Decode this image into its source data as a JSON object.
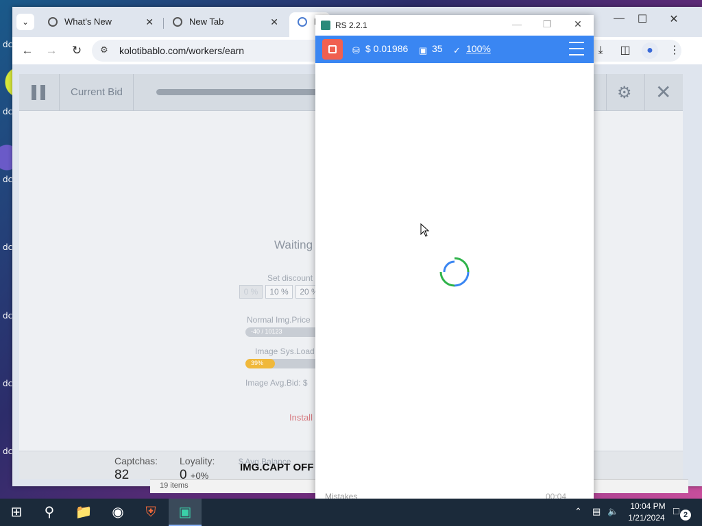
{
  "browser": {
    "tabs": [
      {
        "title": "What's New"
      },
      {
        "title": "New Tab"
      },
      {
        "title": "K"
      }
    ],
    "url": "kolotibablo.com/workers/earn"
  },
  "worker": {
    "current_bid_label": "Current Bid",
    "waiting_text": "Waiting",
    "discount_label": "Set discount",
    "discount_options": [
      "0 %",
      "10 %",
      "20 %"
    ],
    "normal_price_label": "Normal Img.Price",
    "normal_price_value": "-40 / 10123",
    "sys_load_label": "Image Sys.Load",
    "sys_load_value": "39%",
    "sys_load_fraction": 0.39,
    "avg_bid_label": "Image Avg.Bid: $",
    "install_text": "Install",
    "footer": {
      "captchas_label": "Captchas:",
      "captchas_value": "82",
      "loyalty_label": "Loyality:",
      "loyalty_value": "0",
      "loyalty_change": "+0%",
      "avg_balance_label": "$ Avg.Balance",
      "imgcapt_status": "IMG.CAPT OFF"
    }
  },
  "rs_window": {
    "title": "RS 2.2.1",
    "balance": "$ 0.01986",
    "images": "35",
    "accuracy": "100%",
    "mistakes_label": "Mistakes",
    "footer_balance": "00:04"
  },
  "behind_window": {
    "items_text": "19 items"
  },
  "taskbar": {
    "time": "10:04 PM",
    "date": "1/21/2024",
    "notifications": "2"
  },
  "colors": {
    "rs_bar": "#3a86f2",
    "rs_stop": "#f06050",
    "load_fill": "#f0b83a",
    "install": "#d67a80"
  }
}
